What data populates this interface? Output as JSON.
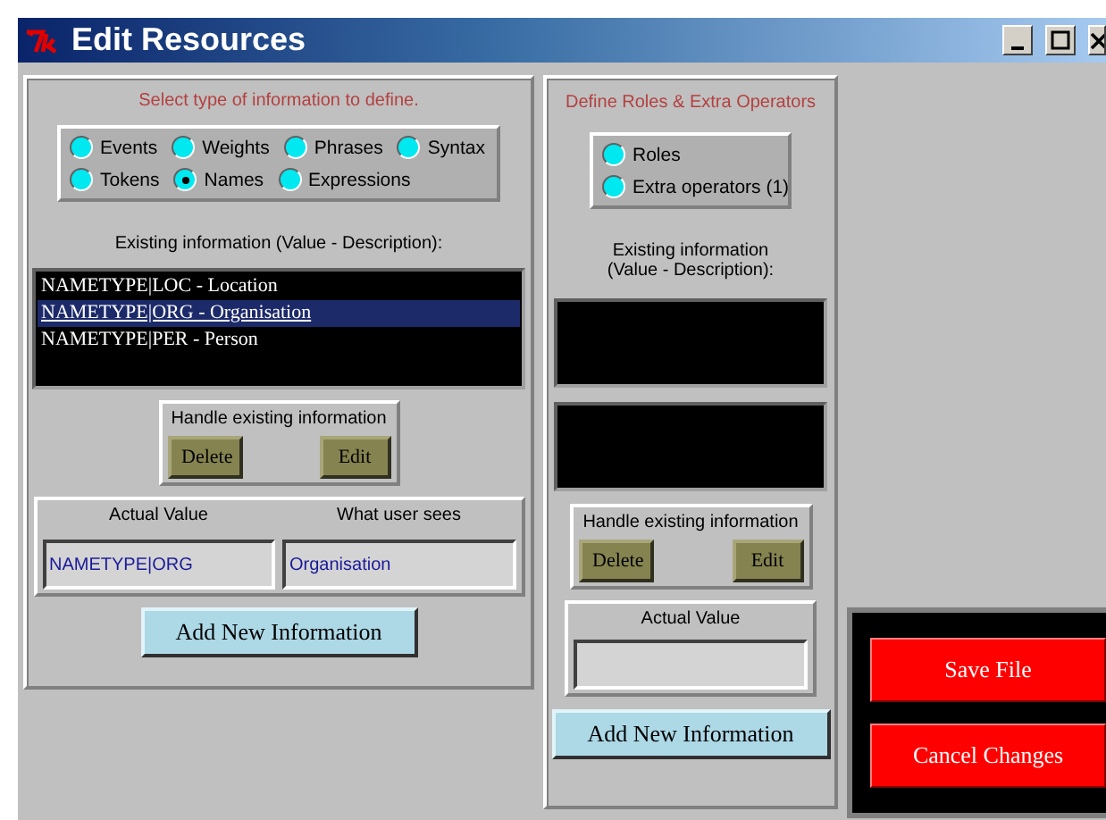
{
  "window": {
    "title": "Edit Resources"
  },
  "information_panel": {
    "heading": "Select type of information to define.",
    "types": [
      {
        "label": "Events",
        "selected": false
      },
      {
        "label": "Weights",
        "selected": false
      },
      {
        "label": "Phrases",
        "selected": false
      },
      {
        "label": "Syntax",
        "selected": false
      },
      {
        "label": "Tokens",
        "selected": false
      },
      {
        "label": "Names",
        "selected": true
      },
      {
        "label": "Expressions",
        "selected": false
      }
    ],
    "list_label": "Existing information (Value - Description):",
    "items": [
      {
        "text": "NAMETYPE|LOC - Location",
        "selected": false
      },
      {
        "text": "NAMETYPE|ORG - Organisation",
        "selected": true
      },
      {
        "text": "NAMETYPE|PER - Person",
        "selected": false
      }
    ],
    "handle": {
      "label": "Handle existing information",
      "buttons": [
        "Delete",
        "Edit"
      ]
    },
    "actual_value": {
      "label": "Actual Value",
      "value": "NAMETYPE|ORG"
    },
    "user_sees": {
      "label": "What user sees",
      "value": "Organisation"
    },
    "add_button": "Add New Information"
  },
  "roles_panel": {
    "heading": "Define Roles & Extra Operators",
    "types": [
      {
        "label": "Roles",
        "selected": false
      },
      {
        "label": "Extra operators (1)",
        "selected": false
      }
    ],
    "list_label": "Existing information (Value - Description):",
    "handle": {
      "label": "Handle existing information",
      "buttons": [
        "Delete",
        "Edit"
      ]
    },
    "actual_value": {
      "label": "Actual Value"
    },
    "add_button": "Add New Information"
  },
  "actions": [
    "Save File",
    "Cancel Changes"
  ]
}
